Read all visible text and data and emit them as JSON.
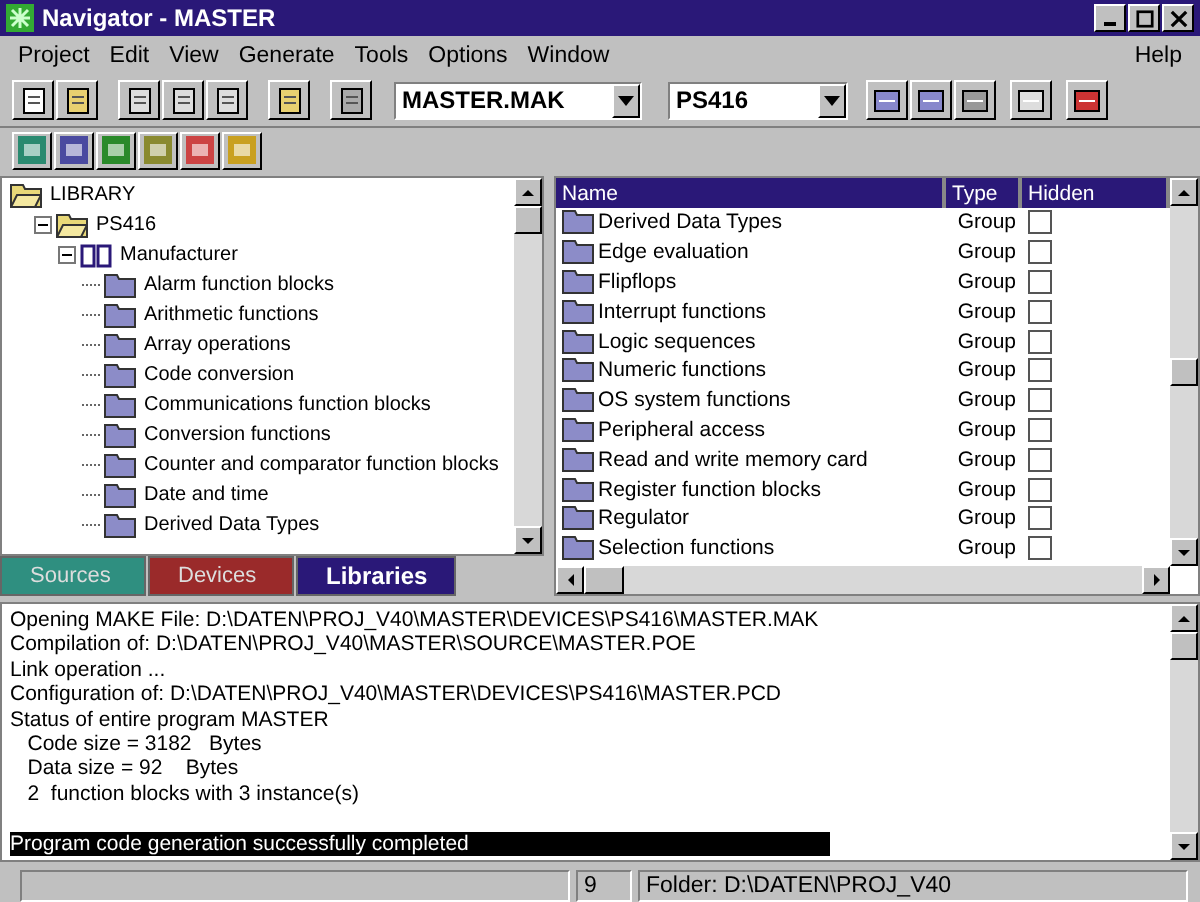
{
  "window": {
    "title": "Navigator - MASTER"
  },
  "menu": {
    "items": [
      "Project",
      "Edit",
      "View",
      "Generate",
      "Tools",
      "Options",
      "Window"
    ],
    "help": "Help"
  },
  "toolbar": {
    "make_file": "MASTER.MAK",
    "device": "PS416"
  },
  "tree": [
    {
      "label": "LIBRARY",
      "kind": "root",
      "children": [
        {
          "label": "PS416",
          "expanded": true,
          "children": [
            {
              "label": "Manufacturer",
              "kind": "book",
              "expanded": true,
              "children": [
                {
                  "label": "Alarm function blocks",
                  "kind": "group"
                },
                {
                  "label": "Arithmetic functions",
                  "kind": "group"
                },
                {
                  "label": "Array operations",
                  "kind": "group"
                },
                {
                  "label": "Code conversion",
                  "kind": "group"
                },
                {
                  "label": "Communications function blocks",
                  "kind": "group"
                },
                {
                  "label": "Conversion functions",
                  "kind": "group"
                },
                {
                  "label": "Counter and comparator function blocks",
                  "kind": "group"
                },
                {
                  "label": "Date and time",
                  "kind": "group"
                },
                {
                  "label": "Derived Data Types",
                  "kind": "group"
                }
              ]
            }
          ]
        }
      ]
    }
  ],
  "tabs": [
    {
      "label": "Sources",
      "selected": false,
      "color": "#2f8f80"
    },
    {
      "label": "Devices",
      "selected": false,
      "color": "#9a2a2a"
    },
    {
      "label": "Libraries",
      "selected": true,
      "color": "#2a1878"
    }
  ],
  "table": {
    "columns": [
      "Name",
      "Type",
      "Hidden"
    ],
    "rows": [
      {
        "name": "Derived Data Types",
        "type": "Group",
        "hidden": false
      },
      {
        "name": "Edge evaluation",
        "type": "Group",
        "hidden": false
      },
      {
        "name": "Flipflops",
        "type": "Group",
        "hidden": false
      },
      {
        "name": "Interrupt functions",
        "type": "Group",
        "hidden": false
      },
      {
        "name": "Logic sequences",
        "type": "Group",
        "hidden": false
      },
      {
        "name": "Numeric functions",
        "type": "Group",
        "hidden": false
      },
      {
        "name": "OS system functions",
        "type": "Group",
        "hidden": false
      },
      {
        "name": "Peripheral access",
        "type": "Group",
        "hidden": false
      },
      {
        "name": "Read and write memory card",
        "type": "Group",
        "hidden": false
      },
      {
        "name": "Register function blocks",
        "type": "Group",
        "hidden": false
      },
      {
        "name": "Regulator",
        "type": "Group",
        "hidden": false
      },
      {
        "name": "Selection functions",
        "type": "Group",
        "hidden": false
      }
    ]
  },
  "log": {
    "lines": [
      {
        "text": "Opening MAKE File: D:\\DATEN\\PROJ_V40\\MASTER\\DEVICES\\PS416\\MASTER.MAK",
        "selected": false
      },
      {
        "text": "Compilation of: D:\\DATEN\\PROJ_V40\\MASTER\\SOURCE\\MASTER.POE",
        "selected": false
      },
      {
        "text": "Link operation ...",
        "selected": false
      },
      {
        "text": "Configuration of: D:\\DATEN\\PROJ_V40\\MASTER\\DEVICES\\PS416\\MASTER.PCD",
        "selected": false
      },
      {
        "text": "Status of entire program MASTER",
        "selected": false
      },
      {
        "text": "   Code size = 3182   Bytes",
        "selected": false
      },
      {
        "text": "   Data size = 92    Bytes",
        "selected": false
      },
      {
        "text": "   2  function blocks with 3 instance(s)",
        "selected": false
      }
    ],
    "result": {
      "text": "Program code generation successfully completed",
      "selected": true
    }
  },
  "status_bar": {
    "count": "9",
    "folder": "Folder: D:\\DATEN\\PROJ_V40"
  }
}
